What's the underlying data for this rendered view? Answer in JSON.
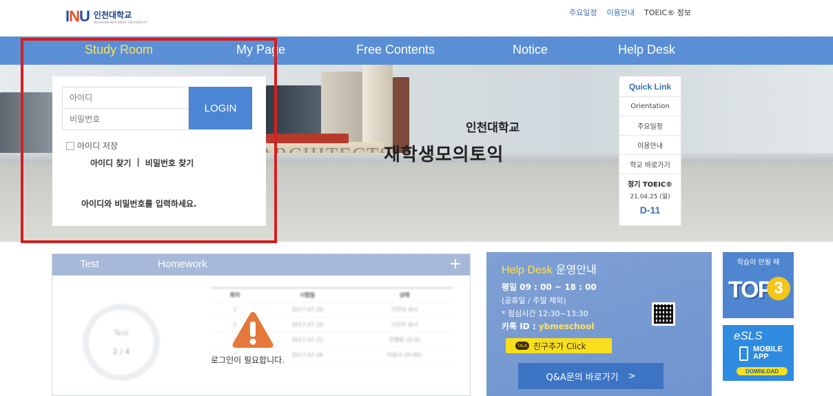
{
  "header": {
    "logo_mark": [
      "I",
      "N",
      "U"
    ],
    "logo_korean": "인천대학교",
    "logo_english": "INCHEON NATIONAL UNIVERSITY",
    "top_links": [
      "주요일정",
      "이용안내",
      "TOEIC® 정보"
    ]
  },
  "nav": {
    "items": [
      "Study Room",
      "My Page",
      "Free Contents",
      "Notice",
      "Help Desk"
    ],
    "active": "Study Room",
    "color": "#5a8fd6",
    "active_color": "#ffe15a"
  },
  "hero": {
    "book_spine_text": [
      "ARCHITECTS"
    ],
    "title": "인천대학교",
    "subtitle": "재학생모의토익"
  },
  "login": {
    "id_placeholder": "아이디",
    "pw_placeholder": "비밀번호",
    "login_label": "LOGIN",
    "remember_label": "아이디 저장",
    "find_id": "아이디 찾기",
    "separator": "|",
    "find_pw": "비밀번호 찾기",
    "message": "아이디와 비밀번호를 입력하세요."
  },
  "quick_link": {
    "title": "Quick Link",
    "items": [
      "Orientation",
      "주요일정",
      "이용안내",
      "학교 바로가기"
    ],
    "exam_title": "정기 TOEIC®",
    "exam_date": "21.04.25 (일)",
    "dday": "D-11"
  },
  "test_panel": {
    "tabs": [
      "Test",
      "Homework"
    ],
    "plus": "+",
    "progress_label": "Test",
    "progress_value": "2 / 4",
    "table_header": [
      "회차",
      "시험일",
      "상태"
    ],
    "table_rows": [
      [
        "1",
        "2017.07.20",
        "기간내 응시"
      ],
      [
        "2",
        "2017.07.20",
        "기간부 응시"
      ],
      [
        "3",
        "2017.07.22",
        "진행중 (D-9)"
      ],
      [
        "4",
        "2017.07.26",
        "미응시 (D-90)"
      ]
    ],
    "login_required": "로그인이 필요합니다."
  },
  "help_desk": {
    "title_en": "Help Desk",
    "title_kr": "운영안내",
    "hours": "평일 09 : 00 ~ 18 : 00",
    "holiday": "(공휴일 / 주말 제외)",
    "lunch": "* 점심시간 12:30~13:30",
    "kakao_label": "카톡 ID :",
    "kakao_id": "ybmeschool",
    "talk_badge": "TALK",
    "friend_button": "친구추가 Click",
    "qa_button": "Q&A문의 바로가기",
    "qa_arrow": ">"
  },
  "banners": {
    "top3_caption": "학습이 안될 때",
    "top3_word": "TOP",
    "top3_num": "3",
    "esls_logo": "eSLS",
    "mobile_line1": "MOBILE",
    "mobile_line2": "APP",
    "download": "DOWNLOAD"
  }
}
